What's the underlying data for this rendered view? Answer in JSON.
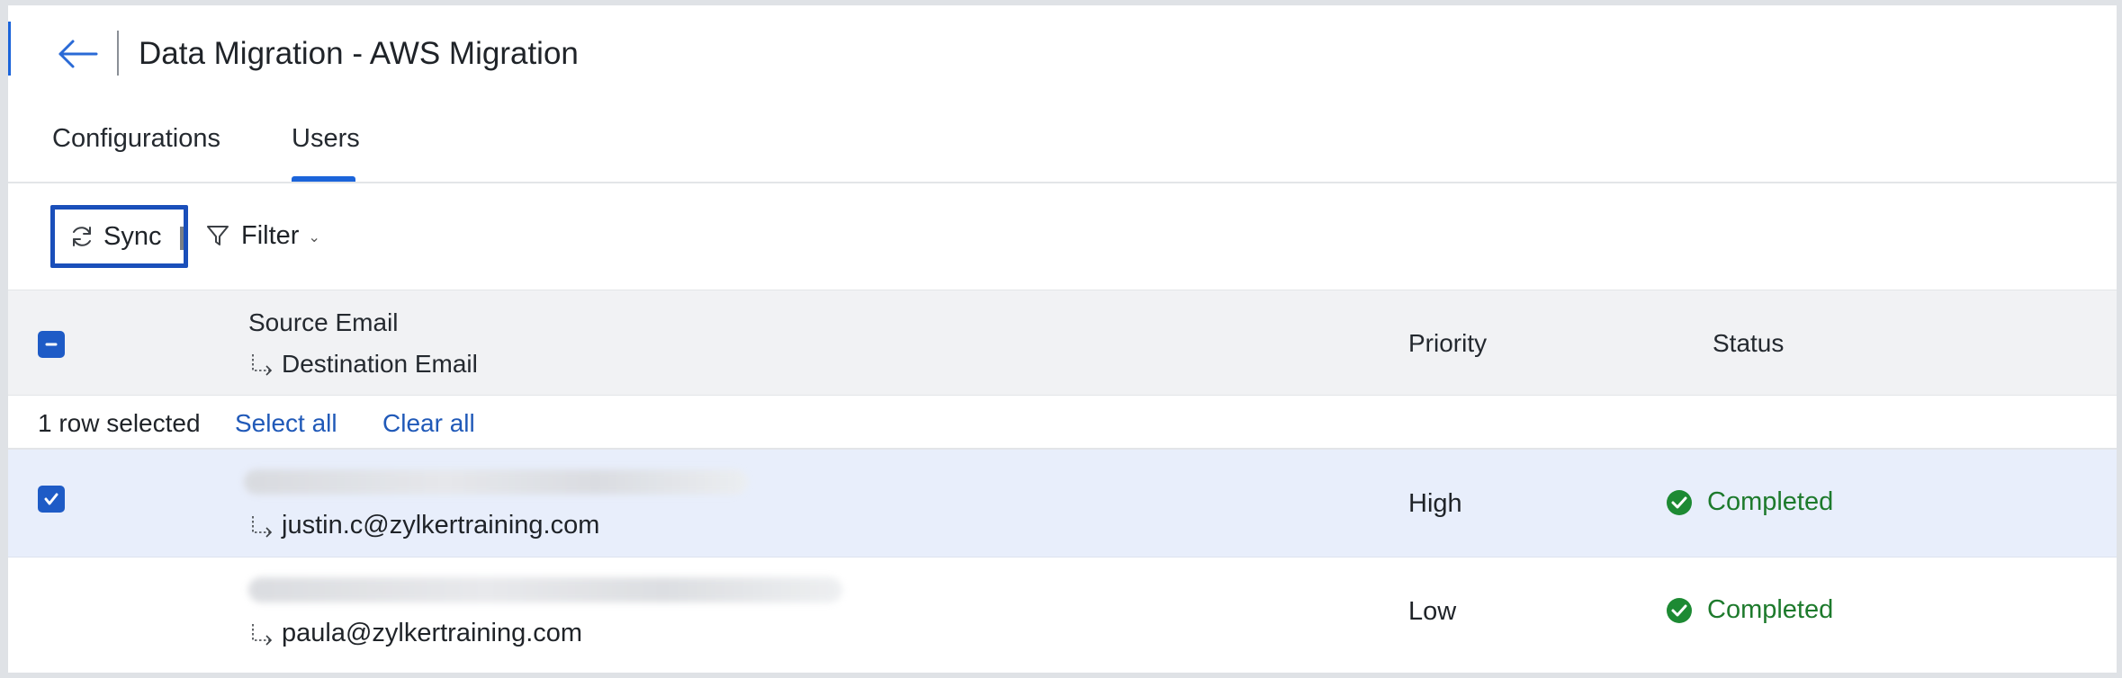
{
  "header": {
    "title": "Data Migration - AWS Migration"
  },
  "tabs": [
    {
      "label": "Configurations"
    },
    {
      "label": "Users",
      "active": true
    }
  ],
  "toolbar": {
    "sync_label": "Sync",
    "filter_label": "Filter"
  },
  "table": {
    "columns": {
      "source": "Source Email",
      "destination": "Destination Email",
      "priority": "Priority",
      "status": "Status"
    }
  },
  "selection": {
    "count_text": "1 row selected",
    "select_all": "Select all",
    "clear_all": "Clear all"
  },
  "rows": [
    {
      "source_email": "",
      "destination_email": "justin.c@zylkertraining.com",
      "priority": "High",
      "status": "Completed",
      "selected": true
    },
    {
      "source_email": "",
      "destination_email": "paula@zylkertraining.com",
      "priority": "Low",
      "status": "Completed",
      "selected": false
    }
  ],
  "colors": {
    "accent": "#1b64da",
    "checkbox": "#1e5bc6",
    "link": "#2059b8",
    "success": "#1d7a2c",
    "selected_row": "#e8eefb",
    "header_bg": "#f1f2f4"
  },
  "icons": {
    "back": "arrow-left-icon",
    "sync": "refresh-icon",
    "filter": "funnel-icon",
    "indent": "indent-arrow-icon",
    "status": "check-circle-icon"
  }
}
